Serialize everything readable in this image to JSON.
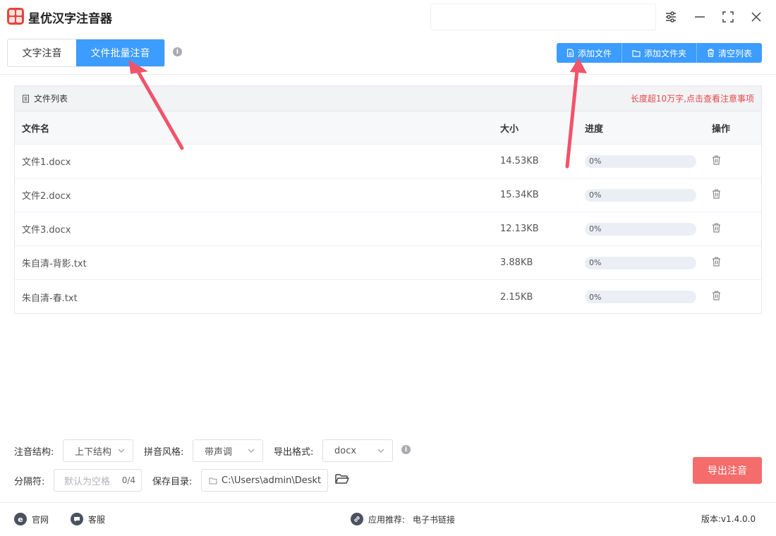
{
  "app": {
    "title": "星优汉字注音器"
  },
  "tabs": [
    {
      "label": "文字注音",
      "active": false
    },
    {
      "label": "文件批量注音",
      "active": true
    }
  ],
  "toolbar": {
    "add_file": "添加文件",
    "add_folder": "添加文件夹",
    "clear_list": "清空列表"
  },
  "file_list": {
    "title": "文件列表",
    "warning": "长度超10万字,点击查看注意事项",
    "columns": [
      "文件名",
      "大小",
      "进度",
      "操作"
    ],
    "rows": [
      {
        "name": "文件1.docx",
        "size": "14.53KB",
        "progress": "0%",
        "progress_value": 0
      },
      {
        "name": "文件2.docx",
        "size": "15.34KB",
        "progress": "0%",
        "progress_value": 0
      },
      {
        "name": "文件3.docx",
        "size": "12.13KB",
        "progress": "0%",
        "progress_value": 0
      },
      {
        "name": "朱自清-背影.txt",
        "size": "3.88KB",
        "progress": "0%",
        "progress_value": 0
      },
      {
        "name": "朱自清-春.txt",
        "size": "2.15KB",
        "progress": "0%",
        "progress_value": 0
      }
    ]
  },
  "settings": {
    "structure_label": "注音结构:",
    "structure_value": "上下结构",
    "style_label": "拼音风格:",
    "style_value": "带声调",
    "format_label": "导出格式:",
    "format_value": "docx",
    "separator_label": "分隔符:",
    "separator_placeholder": "默认为空格",
    "separator_count": "0/4",
    "save_label": "保存目录:",
    "save_path": "C:\\Users\\admin\\Deskto"
  },
  "export_button": "导出注音",
  "footer": {
    "website": "官网",
    "support": "客服",
    "recommend_label": "应用推荐:",
    "recommend_link": "电子书链接",
    "version": "版本:v1.4.0.0"
  },
  "colors": {
    "primary": "#3c9cff",
    "danger": "#f56c6c",
    "warning_text": "#e24a4a",
    "annotation_arrow": "#f1536b"
  }
}
